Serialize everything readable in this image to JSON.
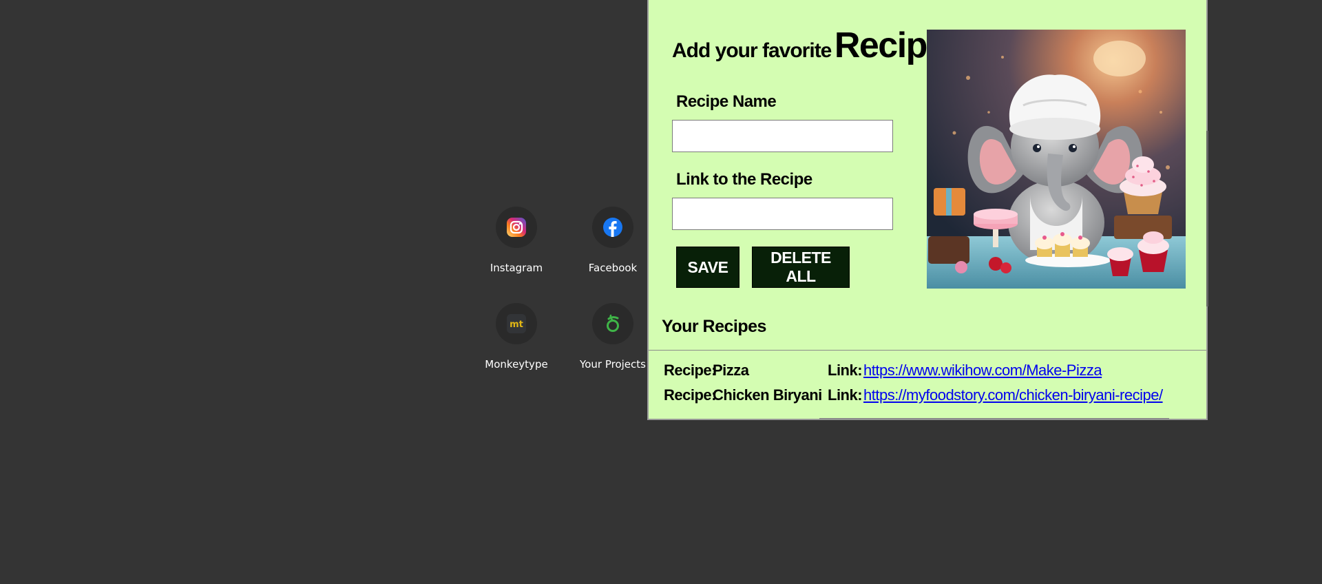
{
  "shortcuts": [
    {
      "label": "Instagram",
      "icon": "instagram-icon"
    },
    {
      "label": "Facebook",
      "icon": "facebook-icon"
    },
    {
      "label": "Monkeytype",
      "icon": "monkeytype-icon",
      "glyph": "mt"
    },
    {
      "label": "Your Projects",
      "icon": "projects-icon"
    }
  ],
  "popup": {
    "heading_small": "Add your favorite",
    "heading_big": "Recipes",
    "recipe_name_label": "Recipe Name",
    "recipe_name_value": "",
    "link_label": "Link to the Recipe",
    "link_value": "",
    "save_label": "SAVE",
    "delete_label": "DELETE ALL",
    "hero_image": "chef-elephant-with-cupcakes-image",
    "your_recipes_title": "Your Recipes",
    "recipes": [
      {
        "recipe_prefix": "Recipe:",
        "name": "Pizza",
        "link_prefix": "Link:",
        "url": "https://www.wikihow.com/Make-Pizza"
      },
      {
        "recipe_prefix": "Recipe:",
        "name": "Chicken Biryani",
        "link_prefix": "Link:",
        "url": "https://myfoodstory.com/chicken-biryani-recipe/"
      }
    ]
  },
  "colors": {
    "page_bg": "#343434",
    "popup_bg": "#d4fdb2",
    "button_bg": "#082008",
    "link": "#0000ee"
  }
}
